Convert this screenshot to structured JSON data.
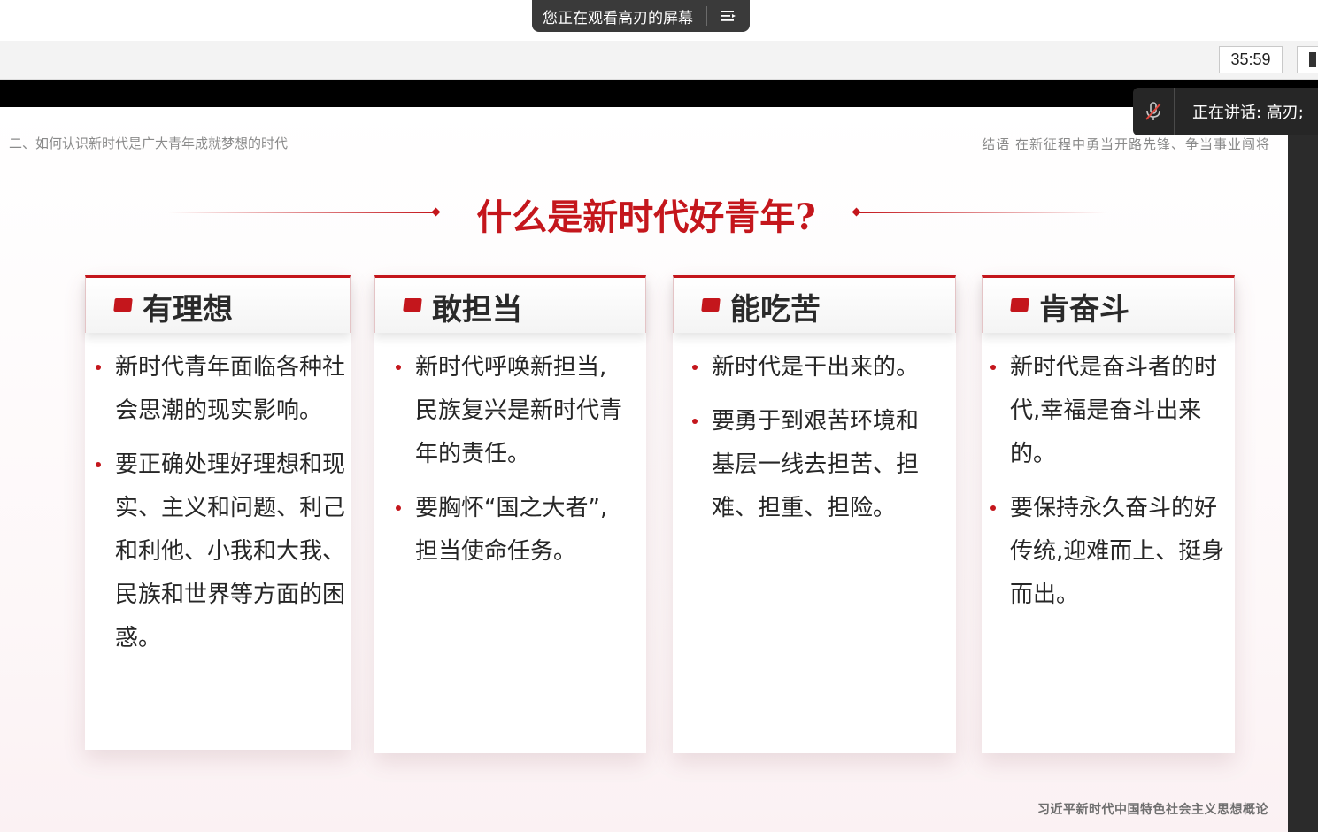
{
  "share_banner": {
    "text": "您正在观看高刃的屏幕",
    "menu_icon": "menu-icon"
  },
  "toolbar": {
    "timer": "35:59"
  },
  "speaker": {
    "mic_icon": "mic-muted-icon",
    "label": "正在讲话: 高刃;"
  },
  "slide": {
    "header_left": "二、如何认识新时代是广大青年成就梦想的时代",
    "header_right": "结语 在新征程中勇当开路先锋、争当事业闯将",
    "title": "什么是新时代好青年?",
    "footer": "习近平新时代中国特色社会主义思想概论",
    "accent_color": "#c4161c",
    "cards": [
      {
        "title": "有理想",
        "bullets": [
          "新时代青年面临各种社会思潮的现实影响。",
          "要正确处理好理想和现实、主义和问题、利己和利他、小我和大我、民族和世界等方面的困惑。"
        ]
      },
      {
        "title": "敢担当",
        "bullets": [
          "新时代呼唤新担当,民族复兴是新时代青年的责任。",
          "要胸怀“国之大者”,担当使命任务。"
        ]
      },
      {
        "title": "能吃苦",
        "bullets": [
          "新时代是干出来的。",
          "要勇于到艰苦环境和基层一线去担苦、担难、担重、担险。"
        ]
      },
      {
        "title": "肯奋斗",
        "bullets": [
          "新时代是奋斗者的时代,幸福是奋斗出来的。",
          "要保持永久奋斗的好传统,迎难而上、挺身而出。"
        ]
      }
    ]
  }
}
